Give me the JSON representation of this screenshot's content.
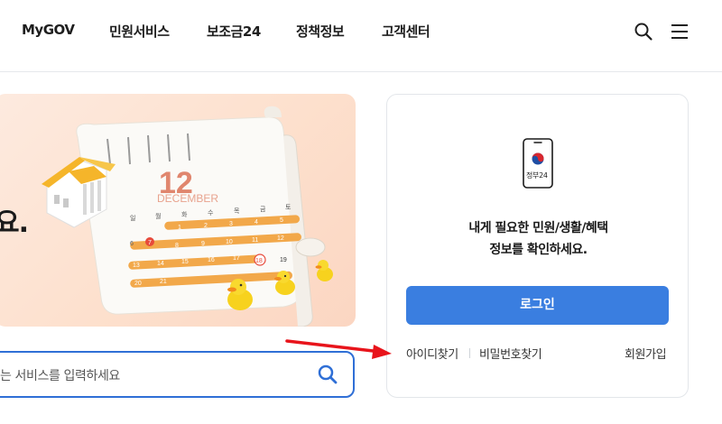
{
  "header": {
    "logo": "MyGOV",
    "nav": [
      "민원서비스",
      "보조금24",
      "정책정보",
      "고객센터"
    ],
    "search_icon": "search-icon",
    "menu_icon": "hamburger-menu-icon"
  },
  "banner": {
    "text_fragment": "요.",
    "illustration": {
      "calendar_month_number": "12",
      "calendar_month_name": "DECEMBER",
      "weekdays": [
        "일",
        "월",
        "화",
        "수",
        "목",
        "금",
        "토"
      ],
      "days": [
        "1",
        "2",
        "3",
        "4",
        "5",
        "6",
        "7",
        "8",
        "9",
        "10",
        "11",
        "12",
        "13",
        "14",
        "15",
        "16",
        "17",
        "18",
        "19",
        "20",
        "21"
      ]
    }
  },
  "search": {
    "placeholder_fragment": "는 서비스를 입력하세요"
  },
  "card": {
    "app_label": "정부24",
    "message_line1": "내게 필요한 민원/생활/혜택",
    "message_line2": "정보를 확인하세요.",
    "login_label": "로그인",
    "find_id_label": "아이디찾기",
    "find_password_label": "비밀번호찾기",
    "signup_label": "회원가입"
  },
  "colors": {
    "primary_blue": "#3a7ee0",
    "search_border": "#2f6fd6",
    "annotation_red": "#e8141b",
    "banner_bg": "#fde3d2",
    "calendar_orange": "#f0a040"
  }
}
